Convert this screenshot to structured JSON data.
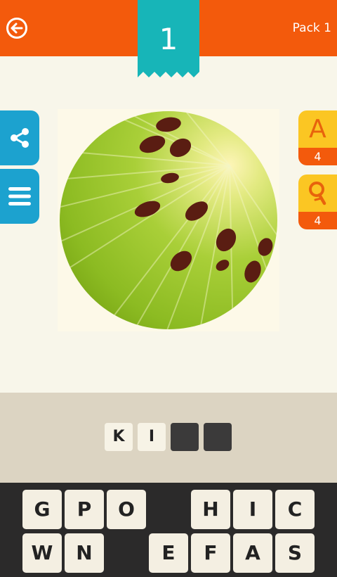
{
  "header": {
    "pack_label": "Pack 1",
    "level_number": "1"
  },
  "hints": {
    "letters": {
      "glyph": "A",
      "count": "4"
    },
    "magnify": {
      "count": "4"
    }
  },
  "answer": {
    "slots": [
      "K",
      "I",
      "",
      ""
    ]
  },
  "keyboard": {
    "row1": [
      "G",
      "P",
      "O",
      "",
      "H",
      "I",
      "C"
    ],
    "row2": [
      "W",
      "N",
      "",
      "E",
      "F",
      "A",
      "S"
    ]
  },
  "colors": {
    "header": "#f35a0c",
    "ribbon": "#17b5b8",
    "side": "#1ca2cf",
    "hint": "#fbc623"
  }
}
